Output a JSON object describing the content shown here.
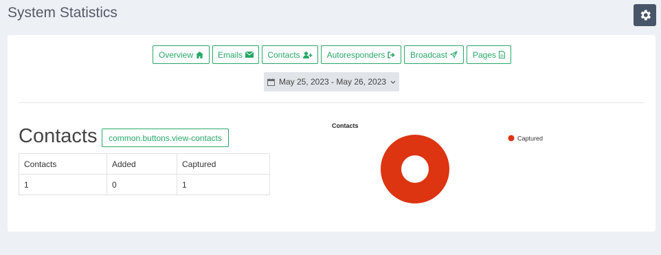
{
  "page": {
    "title": "System Statistics"
  },
  "nav": {
    "buttons": [
      {
        "label": "Overview",
        "icon": "home-icon"
      },
      {
        "label": "Emails",
        "icon": "envelope-icon"
      },
      {
        "label": "Contacts",
        "icon": "user-plus-icon"
      },
      {
        "label": "Autoresponders",
        "icon": "sign-out-icon"
      },
      {
        "label": "Broadcast",
        "icon": "paper-plane-icon"
      },
      {
        "label": "Pages",
        "icon": "file-icon"
      }
    ]
  },
  "date_range": {
    "label": "May 25, 2023 - May 26, 2023"
  },
  "section": {
    "title": "Contacts",
    "view_button": "common.buttons.view-contacts"
  },
  "table": {
    "headers": [
      "Contacts",
      "Added",
      "Captured"
    ],
    "rows": [
      [
        "1",
        "0",
        "1"
      ]
    ]
  },
  "colors": {
    "accent": "#26a867",
    "captured": "#dd3412",
    "settings_bg": "#485569"
  },
  "chart_data": {
    "type": "pie",
    "title": "Contacts",
    "categories": [
      "Captured"
    ],
    "values": [
      1
    ],
    "donut": true,
    "legend": "top-right"
  }
}
